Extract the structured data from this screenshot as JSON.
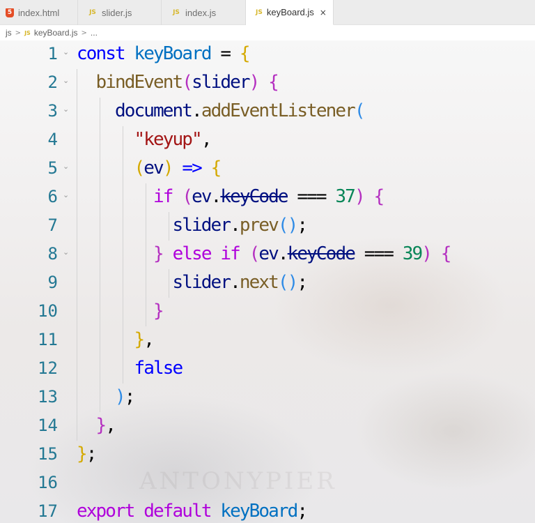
{
  "tabs": [
    {
      "label": "index.html",
      "icon": "html5-icon",
      "active": false
    },
    {
      "label": "slider.js",
      "icon": "js-file-icon",
      "active": false
    },
    {
      "label": "index.js",
      "icon": "js-file-icon",
      "active": false
    },
    {
      "label": "keyBoard.js",
      "icon": "js-file-icon",
      "active": true
    }
  ],
  "tab_icon_text": {
    "js": "JS",
    "html": "5"
  },
  "close_icon": "×",
  "breadcrumb": {
    "folder": "js",
    "file": "keyBoard.js",
    "symbol": "...",
    "separator": ">"
  },
  "editor": {
    "line_numbers": [
      "1",
      "2",
      "3",
      "4",
      "5",
      "6",
      "7",
      "8",
      "9",
      "10",
      "11",
      "12",
      "13",
      "14",
      "15",
      "16",
      "17"
    ],
    "fold_marker": "⌄",
    "watermark": "ANTONYPIER",
    "tokens": {
      "const": "const",
      "keyBoard": "keyBoard",
      "eq": " = ",
      "lbrace": "{",
      "rbrace": "}",
      "bindEvent": "bindEvent",
      "lparen": "(",
      "rparen": ")",
      "slider": "slider",
      "document": "document",
      "dot": ".",
      "addEventListener": "addEventListener",
      "keyup": "\"keyup\"",
      "comma": ",",
      "ev": "ev",
      "arrow": " => ",
      "if": "if",
      "keyCode": "keyCode",
      "strict_eq": " === ",
      "n37": "37",
      "n39": "39",
      "prev": "prev",
      "next": "next",
      "else": "else",
      "semicolon": ";",
      "false": "false",
      "export": "export",
      "default": "default"
    },
    "colors": {
      "keyword": "#0000ff",
      "control": "#af00db",
      "variable": "#0070c1",
      "property": "#001080",
      "function": "#795e26",
      "string": "#a31515",
      "number": "#098658",
      "line_number": "#237893",
      "bracket_level_1": "#d4a900",
      "bracket_level_2": "#b42fc0",
      "bracket_level_3": "#2f8be6"
    }
  }
}
